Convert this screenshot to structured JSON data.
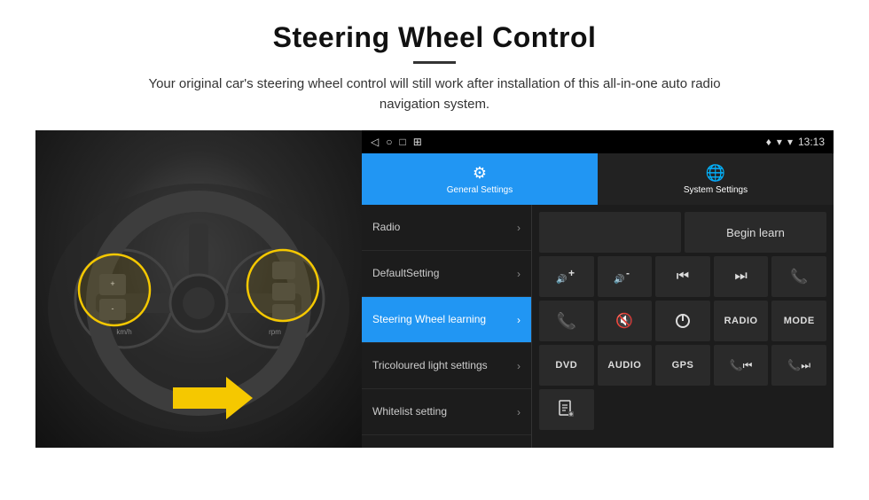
{
  "header": {
    "title": "Steering Wheel Control",
    "subtitle": "Your original car's steering wheel control will still work after installation of this all-in-one auto radio navigation system."
  },
  "status_bar": {
    "icons": [
      "◁",
      "○",
      "□",
      "⊞"
    ],
    "time": "13:13",
    "signal_icons": [
      "▾",
      "▾"
    ]
  },
  "tabs": [
    {
      "id": "general",
      "label": "General Settings",
      "icon": "⚙",
      "active": true
    },
    {
      "id": "system",
      "label": "System Settings",
      "icon": "🌐",
      "active": false
    }
  ],
  "menu_items": [
    {
      "id": "radio",
      "label": "Radio",
      "active": false
    },
    {
      "id": "default",
      "label": "DefaultSetting",
      "active": false
    },
    {
      "id": "steering",
      "label": "Steering Wheel learning",
      "active": true
    },
    {
      "id": "tricoloured",
      "label": "Tricoloured light settings",
      "active": false
    },
    {
      "id": "whitelist",
      "label": "Whitelist setting",
      "active": false
    }
  ],
  "controls": {
    "begin_learn_label": "Begin learn",
    "grid_row1": [
      {
        "icon": "🔊+",
        "type": "icon",
        "label": "vol-up"
      },
      {
        "icon": "🔊-",
        "type": "icon",
        "label": "vol-down"
      },
      {
        "icon": "⏮",
        "type": "icon",
        "label": "prev"
      },
      {
        "icon": "⏭",
        "type": "icon",
        "label": "next"
      },
      {
        "icon": "📞",
        "type": "icon",
        "label": "phone"
      }
    ],
    "grid_row2": [
      {
        "icon": "📞✓",
        "type": "icon",
        "label": "answer"
      },
      {
        "icon": "🔇",
        "type": "icon",
        "label": "mute"
      },
      {
        "icon": "⏻",
        "type": "icon",
        "label": "power"
      },
      {
        "text": "RADIO",
        "type": "text",
        "label": "radio-btn"
      },
      {
        "text": "MODE",
        "type": "text",
        "label": "mode-btn"
      }
    ],
    "grid_row3": [
      {
        "text": "DVD",
        "type": "text",
        "label": "dvd-btn"
      },
      {
        "text": "AUDIO",
        "type": "text",
        "label": "audio-btn"
      },
      {
        "text": "GPS",
        "type": "text",
        "label": "gps-btn"
      },
      {
        "icon": "📞⏮",
        "type": "icon",
        "label": "phone-prev"
      },
      {
        "icon": "📞⏭",
        "type": "icon",
        "label": "phone-next"
      }
    ],
    "grid_row4": [
      {
        "icon": "📄",
        "type": "icon",
        "label": "file"
      }
    ]
  }
}
